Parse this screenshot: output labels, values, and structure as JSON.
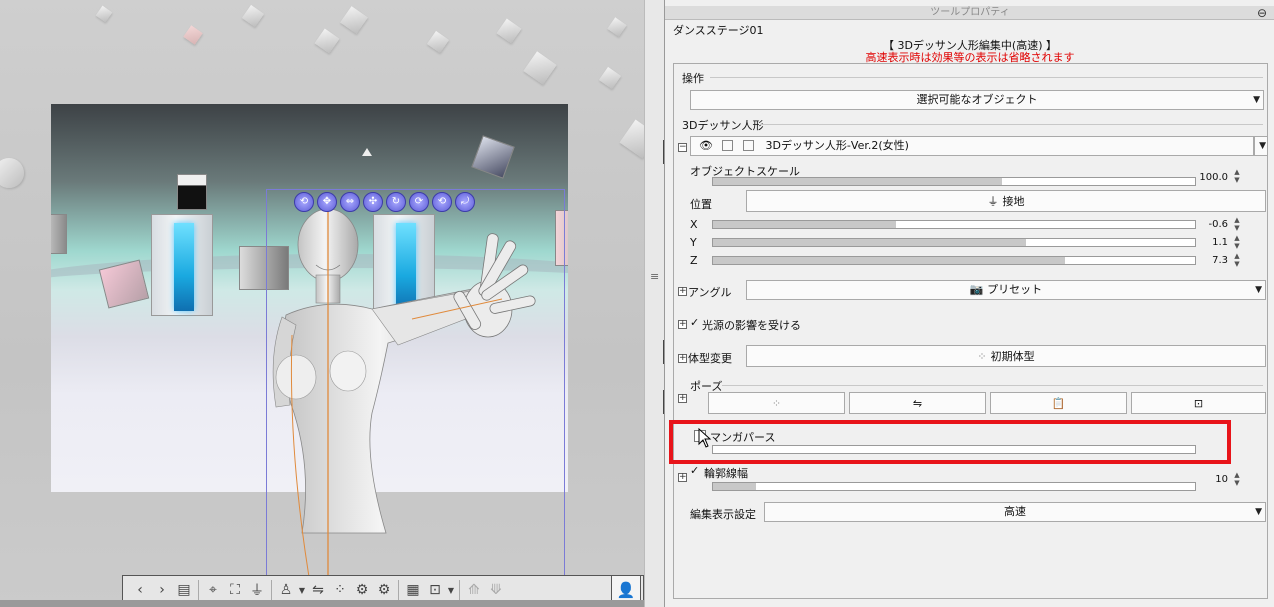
{
  "panel": {
    "title": "ツールプロパティ",
    "tool_name": "ダンスステージ01",
    "mode_title": "【 3Dデッサン人形編集中(高速) 】",
    "mode_note": "高速表示時は効果等の表示は省略されます"
  },
  "operation": {
    "section_label": "操作",
    "selectable_object": "選択可能なオブジェクト"
  },
  "doll": {
    "section_label": "3Dデッサン人形",
    "model_name": "3Dデッサン人形-Ver.2(女性)",
    "object_scale_label": "オブジェクトスケール",
    "object_scale_value": "100.0",
    "object_scale_fraction": 0.6
  },
  "position": {
    "label": "位置",
    "ground_button": "接地",
    "x": {
      "axis": "X",
      "value": "-0.6",
      "fraction": 0.38
    },
    "y": {
      "axis": "Y",
      "value": "1.1",
      "fraction": 0.65
    },
    "z": {
      "axis": "Z",
      "value": "7.3",
      "fraction": 0.73
    }
  },
  "angle": {
    "label": "アングル",
    "preset_label": "プリセット"
  },
  "light": {
    "label": "光源の影響を受ける",
    "checked": true
  },
  "body_shape": {
    "label": "体型変更",
    "initial_button": "初期体型"
  },
  "pose": {
    "label": "ポーズ"
  },
  "manga_perspective": {
    "label": "マンガパース",
    "checked": false
  },
  "outline": {
    "label": "輪郭線幅",
    "value": "10",
    "checked": true,
    "fraction": 0.1
  },
  "edit_display": {
    "label": "編集表示設定",
    "value": "高速"
  },
  "icons": {
    "eye": "eye-icon",
    "ground": "ground-icon",
    "preset": "camera-preset-icon",
    "body": "body-shape-icon",
    "pose_buttons": [
      "pose-dots-icon",
      "flip-pose-icon",
      "clipboard-icon",
      "pose-register-icon"
    ]
  },
  "colors": {
    "highlight": "#e8141a",
    "note": "#e00000",
    "manipulator": "#5c5cd6"
  }
}
